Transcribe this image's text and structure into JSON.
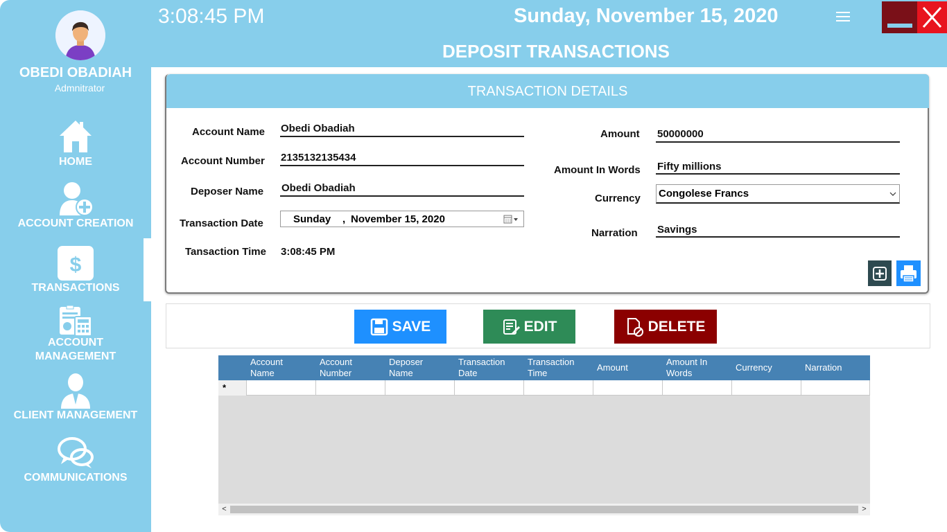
{
  "sidebar": {
    "user_name": "OBEDI OBADIAH",
    "user_role": "Admnitrator",
    "items": [
      {
        "label": "HOME",
        "icon": "home-icon"
      },
      {
        "label": "ACCOUNT CREATION",
        "icon": "add-user-icon"
      },
      {
        "label": "TRANSACTIONS",
        "icon": "dollar-icon"
      },
      {
        "label": "ACCOUNT",
        "label2": "MANAGEMENT",
        "icon": "calculator-icon"
      },
      {
        "label": "CLIENT MANAGEMENT",
        "icon": "client-icon"
      },
      {
        "label": "COMMUNICATIONS",
        "icon": "chat-icon"
      }
    ],
    "selected": "TRANSACTIONS"
  },
  "header": {
    "time": "3:08:45 PM",
    "date": "Sunday, November 15, 2020",
    "title": "DEPOSIT TRANSACTIONS"
  },
  "details": {
    "title": "TRANSACTION DETAILS",
    "account_name_label": "Account Name",
    "account_name": "Obedi Obadiah",
    "account_number_label": "Account Number",
    "account_number": "2135132135434",
    "deposer_name_label": "Deposer Name",
    "deposer_name": "Obedi Obadiah",
    "transaction_date_label": "Transaction Date",
    "transaction_date_day": "Sunday",
    "transaction_date_rest": "November 15, 2020",
    "transaction_time_label": "Tansaction Time",
    "transaction_time": "3:08:45 PM",
    "amount_label": "Amount",
    "amount": "50000000",
    "amount_words_label": "Amount In Words",
    "amount_words": "Fifty millions",
    "currency_label": "Currency",
    "currency": "Congolese Francs",
    "narration_label": "Narration",
    "narration": "Savings"
  },
  "actions": {
    "save": "SAVE",
    "edit": "EDIT",
    "delete": "DELETE"
  },
  "grid": {
    "columns": [
      [
        "Account",
        "Name"
      ],
      [
        "Account",
        "Number"
      ],
      [
        "Deposer",
        "Name"
      ],
      [
        "Transaction",
        "Date"
      ],
      [
        "Transaction",
        "Time"
      ],
      [
        "Amount",
        ""
      ],
      [
        "Amount In",
        "Words"
      ],
      [
        "Currency",
        ""
      ],
      [
        "Narration",
        ""
      ]
    ],
    "new_row_marker": "*"
  },
  "colors": {
    "sidebar": "#87CEEB",
    "save": "#1E90FF",
    "edit": "#2E8B57",
    "delete": "#8B0000",
    "grid_header": "#4682B4",
    "close": "#E8141F",
    "minimize": "#7A1018"
  }
}
